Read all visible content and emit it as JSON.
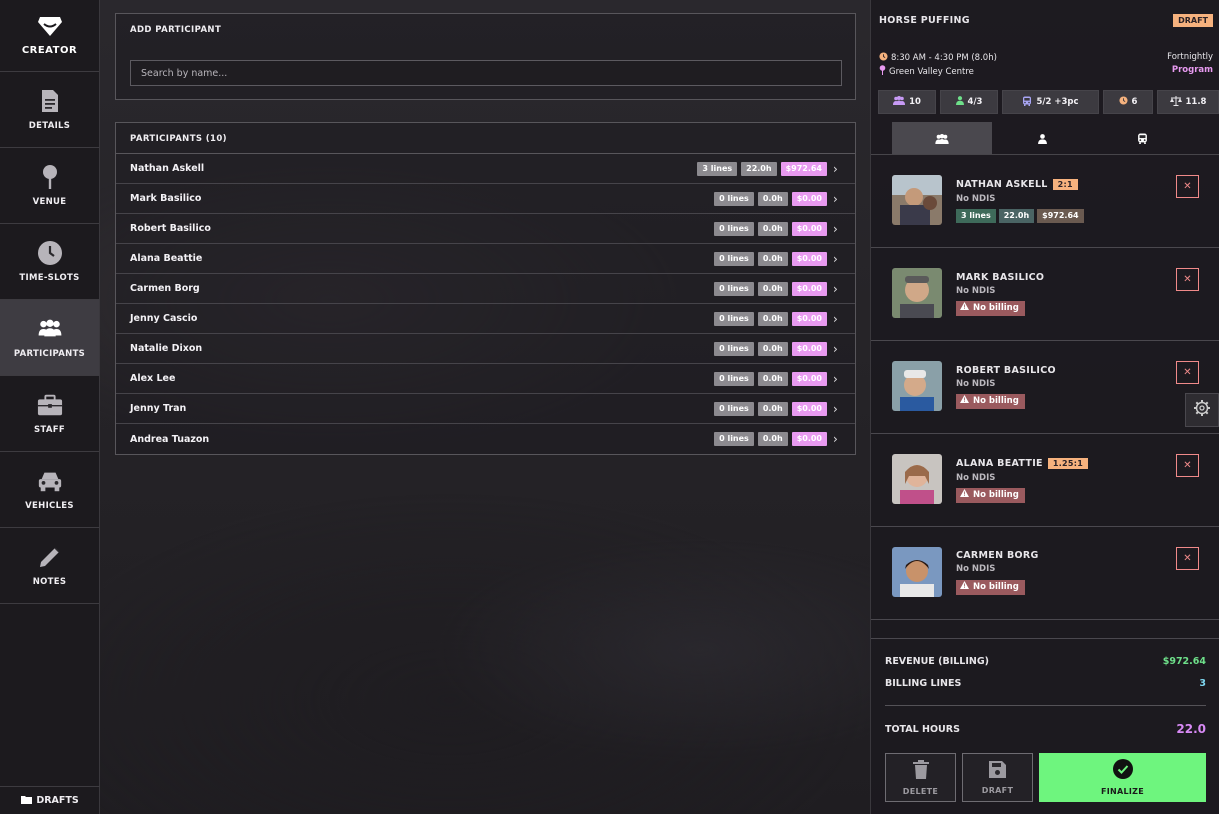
{
  "sidebar": {
    "brand": "CREATOR",
    "items": [
      {
        "label": "DETAILS",
        "icon": "document-icon"
      },
      {
        "label": "VENUE",
        "icon": "pin-icon"
      },
      {
        "label": "TIME-SLOTS",
        "icon": "clock-icon"
      },
      {
        "label": "PARTICIPANTS",
        "icon": "users-icon",
        "active": true
      },
      {
        "label": "STAFF",
        "icon": "briefcase-icon"
      },
      {
        "label": "VEHICLES",
        "icon": "car-icon"
      },
      {
        "label": "NOTES",
        "icon": "pencil-icon"
      }
    ],
    "drafts_label": "DRAFTS"
  },
  "add_participant": {
    "title": "ADD PARTICIPANT",
    "search_placeholder": "Search by name..."
  },
  "participants": {
    "title": "PARTICIPANTS (10)",
    "rows": [
      {
        "name": "Nathan Askell",
        "lines": "3 lines",
        "hours": "22.0h",
        "amount": "$972.64"
      },
      {
        "name": "Mark Basilico",
        "lines": "0 lines",
        "hours": "0.0h",
        "amount": "$0.00"
      },
      {
        "name": "Robert Basilico",
        "lines": "0 lines",
        "hours": "0.0h",
        "amount": "$0.00"
      },
      {
        "name": "Alana Beattie",
        "lines": "0 lines",
        "hours": "0.0h",
        "amount": "$0.00"
      },
      {
        "name": "Carmen Borg",
        "lines": "0 lines",
        "hours": "0.0h",
        "amount": "$0.00"
      },
      {
        "name": "Jenny Cascio",
        "lines": "0 lines",
        "hours": "0.0h",
        "amount": "$0.00"
      },
      {
        "name": "Natalie Dixon",
        "lines": "0 lines",
        "hours": "0.0h",
        "amount": "$0.00"
      },
      {
        "name": "Alex Lee",
        "lines": "0 lines",
        "hours": "0.0h",
        "amount": "$0.00"
      },
      {
        "name": "Jenny Tran",
        "lines": "0 lines",
        "hours": "0.0h",
        "amount": "$0.00"
      },
      {
        "name": "Andrea Tuazon",
        "lines": "0 lines",
        "hours": "0.0h",
        "amount": "$0.00"
      }
    ]
  },
  "activity": {
    "name": "HORSE PUFFING",
    "status": "DRAFT",
    "time": "8:30 AM - 4:30 PM (8.0h)",
    "venue": "Green Valley Centre",
    "frequency": "Fortnightly",
    "type": "Program",
    "stats": {
      "participants": "10",
      "staff": "4/3",
      "vehicles": "5/2 +3pc",
      "slots": "6",
      "ratio": "11.8"
    }
  },
  "cards": [
    {
      "name": "NATHAN ASKELL",
      "ratio": "2:1",
      "ndis": "No NDIS",
      "lines": "3 lines",
      "hours": "22.0h",
      "amount": "$972.64"
    },
    {
      "name": "MARK BASILICO",
      "ndis": "No NDIS",
      "warning": "No billing"
    },
    {
      "name": "ROBERT BASILICO",
      "ndis": "No NDIS",
      "warning": "No billing"
    },
    {
      "name": "ALANA BEATTIE",
      "ratio": "1.25:1",
      "ndis": "No NDIS",
      "warning": "No billing"
    },
    {
      "name": "CARMEN BORG",
      "ndis": "No NDIS",
      "warning": "No billing"
    }
  ],
  "summary": {
    "revenue_label": "REVENUE (BILLING)",
    "revenue_value": "$972.64",
    "lines_label": "BILLING LINES",
    "lines_value": "3",
    "hours_label": "TOTAL HOURS",
    "hours_value": "22.0"
  },
  "actions": {
    "delete": "DELETE",
    "draft": "DRAFT",
    "finalize": "FINALIZE"
  },
  "colors": {
    "accent_pink": "#e89af0",
    "accent_orange": "#f6b27e",
    "accent_green": "#6ef57e",
    "revenue_green": "#6ee08a",
    "lines_cyan": "#7fd8f0",
    "hours_purple": "#d88af5"
  }
}
